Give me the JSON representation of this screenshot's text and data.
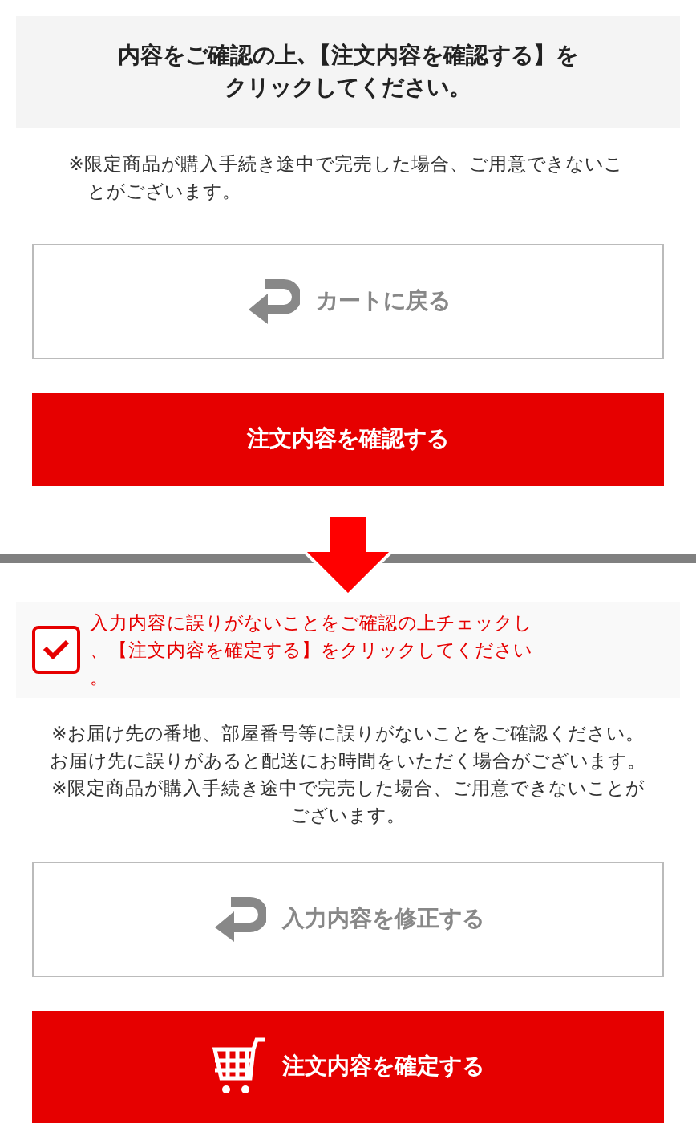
{
  "step1": {
    "heading": "内容をご確認の上､【注文内容を確認する】をクリックしてください。",
    "note": "※限定商品が購入手続き途中で完売した場合、ご用意できないことがございます。",
    "buttons": [
      {
        "kind": "back",
        "label": "カートに戻る"
      },
      {
        "kind": "primary",
        "label": "注文内容を確認する"
      }
    ]
  },
  "step2": {
    "agreement": {
      "checked": true,
      "label": "入力内容に誤りがないことをご確認の上チェックし、【注文内容を確定する】をクリックしてください。"
    },
    "note": "※お届け先の番地、部屋番号等に誤りがないことをご確認ください。お届け先に誤りがあると配送にお時間をいただく場合がございます。\n※限定商品が購入手続き途中で完売した場合、ご用意できないことがございます。",
    "buttons": [
      {
        "kind": "back",
        "label": "入力内容を修正する"
      },
      {
        "kind": "cart",
        "label": "注文内容を確定する"
      }
    ]
  }
}
